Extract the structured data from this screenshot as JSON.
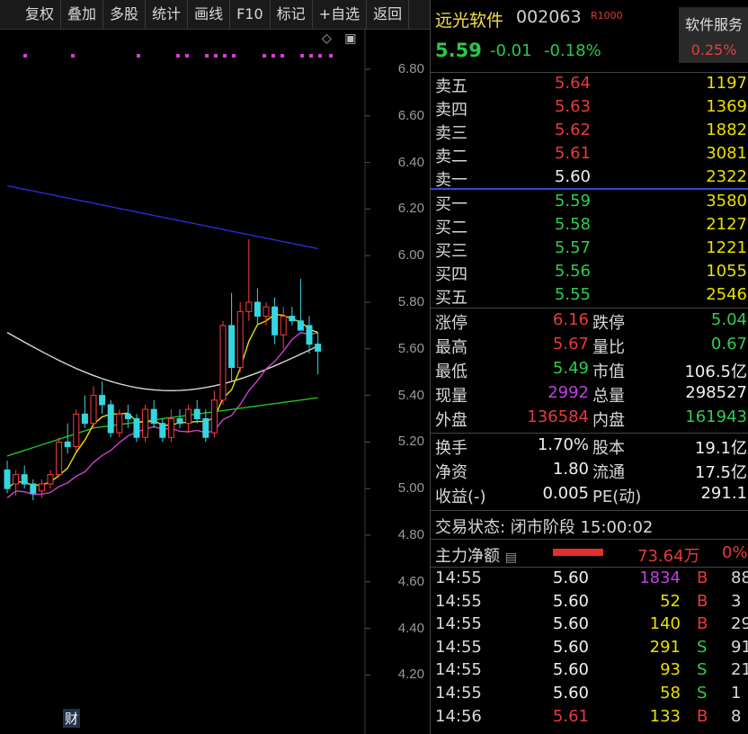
{
  "toolbar": {
    "buttons": [
      "复权",
      "叠加",
      "多股",
      "统计",
      "画线",
      "F10",
      "标记",
      "+自选",
      "返回"
    ]
  },
  "chart": {
    "y_ticks": [
      "6.80",
      "6.60",
      "6.40",
      "6.20",
      "6.00",
      "5.80",
      "5.60",
      "5.40",
      "5.20",
      "5.00",
      "4.80",
      "4.60",
      "4.40",
      "4.20"
    ],
    "cai_label": "财",
    "icons": [
      "diamond-icon",
      "panel-toggle-icon"
    ]
  },
  "chart_data": {
    "type": "candlestick",
    "ylim": [
      4.1,
      6.9
    ],
    "candles": [
      {
        "o": 5.08,
        "h": 5.12,
        "l": 4.98,
        "c": 5.0
      },
      {
        "o": 5.02,
        "h": 5.08,
        "l": 4.97,
        "c": 5.06
      },
      {
        "o": 5.06,
        "h": 5.1,
        "l": 5.0,
        "c": 5.02
      },
      {
        "o": 5.02,
        "h": 5.04,
        "l": 4.95,
        "c": 4.98
      },
      {
        "o": 4.99,
        "h": 5.04,
        "l": 4.96,
        "c": 5.02
      },
      {
        "o": 5.02,
        "h": 5.08,
        "l": 5.0,
        "c": 5.06
      },
      {
        "o": 5.06,
        "h": 5.22,
        "l": 5.05,
        "c": 5.2
      },
      {
        "o": 5.2,
        "h": 5.28,
        "l": 5.15,
        "c": 5.18
      },
      {
        "o": 5.18,
        "h": 5.34,
        "l": 5.16,
        "c": 5.32
      },
      {
        "o": 5.32,
        "h": 5.4,
        "l": 5.26,
        "c": 5.28
      },
      {
        "o": 5.28,
        "h": 5.44,
        "l": 5.26,
        "c": 5.4
      },
      {
        "o": 5.4,
        "h": 5.46,
        "l": 5.32,
        "c": 5.36
      },
      {
        "o": 5.36,
        "h": 5.38,
        "l": 5.22,
        "c": 5.24
      },
      {
        "o": 5.24,
        "h": 5.34,
        "l": 5.22,
        "c": 5.32
      },
      {
        "o": 5.32,
        "h": 5.36,
        "l": 5.26,
        "c": 5.3
      },
      {
        "o": 5.3,
        "h": 5.32,
        "l": 5.2,
        "c": 5.22
      },
      {
        "o": 5.22,
        "h": 5.36,
        "l": 5.2,
        "c": 5.34
      },
      {
        "o": 5.34,
        "h": 5.38,
        "l": 5.26,
        "c": 5.28
      },
      {
        "o": 5.28,
        "h": 5.3,
        "l": 5.2,
        "c": 5.22
      },
      {
        "o": 5.22,
        "h": 5.34,
        "l": 5.2,
        "c": 5.3
      },
      {
        "o": 5.3,
        "h": 5.34,
        "l": 5.26,
        "c": 5.28
      },
      {
        "o": 5.28,
        "h": 5.36,
        "l": 5.24,
        "c": 5.34
      },
      {
        "o": 5.34,
        "h": 5.38,
        "l": 5.28,
        "c": 5.3
      },
      {
        "o": 5.3,
        "h": 5.34,
        "l": 5.2,
        "c": 5.22
      },
      {
        "o": 5.24,
        "h": 5.42,
        "l": 5.22,
        "c": 5.38
      },
      {
        "o": 5.38,
        "h": 5.72,
        "l": 5.36,
        "c": 5.7
      },
      {
        "o": 5.7,
        "h": 5.84,
        "l": 5.46,
        "c": 5.52
      },
      {
        "o": 5.52,
        "h": 5.8,
        "l": 5.5,
        "c": 5.76
      },
      {
        "o": 5.76,
        "h": 6.07,
        "l": 5.72,
        "c": 5.8
      },
      {
        "o": 5.8,
        "h": 5.86,
        "l": 5.7,
        "c": 5.74
      },
      {
        "o": 5.74,
        "h": 5.8,
        "l": 5.7,
        "c": 5.78
      },
      {
        "o": 5.78,
        "h": 5.82,
        "l": 5.62,
        "c": 5.66
      },
      {
        "o": 5.66,
        "h": 5.78,
        "l": 5.6,
        "c": 5.74
      },
      {
        "o": 5.74,
        "h": 5.78,
        "l": 5.7,
        "c": 5.72
      },
      {
        "o": 5.72,
        "h": 5.9,
        "l": 5.7,
        "c": 5.68
      },
      {
        "o": 5.7,
        "h": 5.74,
        "l": 5.58,
        "c": 5.62
      },
      {
        "o": 5.62,
        "h": 5.67,
        "l": 5.49,
        "c": 5.59
      }
    ],
    "ma_lines": [
      {
        "color": "#2b2bd6",
        "values": [
          null,
          null,
          null,
          null,
          null,
          null,
          null,
          null,
          null,
          null,
          null,
          null,
          null,
          null,
          null,
          null,
          null,
          null,
          null,
          null,
          null,
          null,
          null,
          null,
          null,
          null,
          null,
          null,
          null,
          null,
          null,
          null,
          null,
          null,
          null,
          null,
          null
        ]
      },
      {
        "color": "#d8d8d8"
      },
      {
        "color": "#d040d0"
      },
      {
        "color": "#20c020"
      },
      {
        "color": "#e8e000"
      }
    ],
    "marker_color": "#d040d0"
  },
  "panel": {
    "name": "远光软件",
    "code": "002063",
    "badge": "R1000",
    "sector_name": "软件服务",
    "sector_pct": "0.25%",
    "price": "5.59",
    "change": "-0.01",
    "change_pct": "-0.18%",
    "asks": [
      {
        "label": "卖五",
        "price": "5.64",
        "vol": "1197"
      },
      {
        "label": "卖四",
        "price": "5.63",
        "vol": "1369"
      },
      {
        "label": "卖三",
        "price": "5.62",
        "vol": "1882"
      },
      {
        "label": "卖二",
        "price": "5.61",
        "vol": "3081"
      },
      {
        "label": "卖一",
        "price": "5.60",
        "vol": "2322"
      }
    ],
    "bids": [
      {
        "label": "买一",
        "price": "5.59",
        "vol": "3580"
      },
      {
        "label": "买二",
        "price": "5.58",
        "vol": "2127"
      },
      {
        "label": "买三",
        "price": "5.57",
        "vol": "1221"
      },
      {
        "label": "买四",
        "price": "5.56",
        "vol": "1055"
      },
      {
        "label": "买五",
        "price": "5.55",
        "vol": "2546"
      }
    ],
    "stats": [
      {
        "l1": "涨停",
        "v1": "6.16",
        "c1": "red",
        "l2": "跌停",
        "v2": "5.04",
        "c2": "green"
      },
      {
        "l1": "最高",
        "v1": "5.67",
        "c1": "red",
        "l2": "量比",
        "v2": "0.67",
        "c2": "green"
      },
      {
        "l1": "最低",
        "v1": "5.49",
        "c1": "green",
        "l2": "市值",
        "v2": "106.5亿",
        "c2": "white"
      },
      {
        "l1": "现量",
        "v1": "2992",
        "c1": "purple",
        "l2": "总量",
        "v2": "298527",
        "c2": "white"
      },
      {
        "l1": "外盘",
        "v1": "136584",
        "c1": "red",
        "l2": "内盘",
        "v2": "161943",
        "c2": "green"
      },
      {
        "l1": "换手",
        "v1": "1.70%",
        "c1": "white",
        "l2": "股本",
        "v2": "19.1亿",
        "c2": "white"
      },
      {
        "l1": "净资",
        "v1": "1.80",
        "c1": "white",
        "l2": "流通",
        "v2": "17.5亿",
        "c2": "white"
      },
      {
        "l1": "收益(-)",
        "v1": "0.005",
        "c1": "white",
        "l2": "PE(动)",
        "v2": "291.1",
        "c2": "white"
      }
    ],
    "status": "交易状态: 闭市阶段 15:00:02",
    "mainflow_label": "主力净额",
    "mainflow_value": "73.64万",
    "mainflow_pct": "0%",
    "ticks": [
      {
        "time": "14:55",
        "price": "5.60",
        "pc": "white",
        "vol": "1834",
        "vc": "purple",
        "bs": "B",
        "n": "88"
      },
      {
        "time": "14:55",
        "price": "5.60",
        "pc": "white",
        "vol": "52",
        "vc": "yellow",
        "bs": "B",
        "n": "3"
      },
      {
        "time": "14:55",
        "price": "5.60",
        "pc": "white",
        "vol": "140",
        "vc": "yellow",
        "bs": "B",
        "n": "29"
      },
      {
        "time": "14:55",
        "price": "5.60",
        "pc": "white",
        "vol": "291",
        "vc": "yellow",
        "bs": "S",
        "n": "91"
      },
      {
        "time": "14:55",
        "price": "5.60",
        "pc": "white",
        "vol": "93",
        "vc": "yellow",
        "bs": "S",
        "n": "21"
      },
      {
        "time": "14:55",
        "price": "5.60",
        "pc": "white",
        "vol": "58",
        "vc": "yellow",
        "bs": "S",
        "n": "1"
      },
      {
        "time": "14:56",
        "price": "5.61",
        "pc": "red",
        "vol": "133",
        "vc": "yellow",
        "bs": "B",
        "n": "8"
      }
    ]
  }
}
